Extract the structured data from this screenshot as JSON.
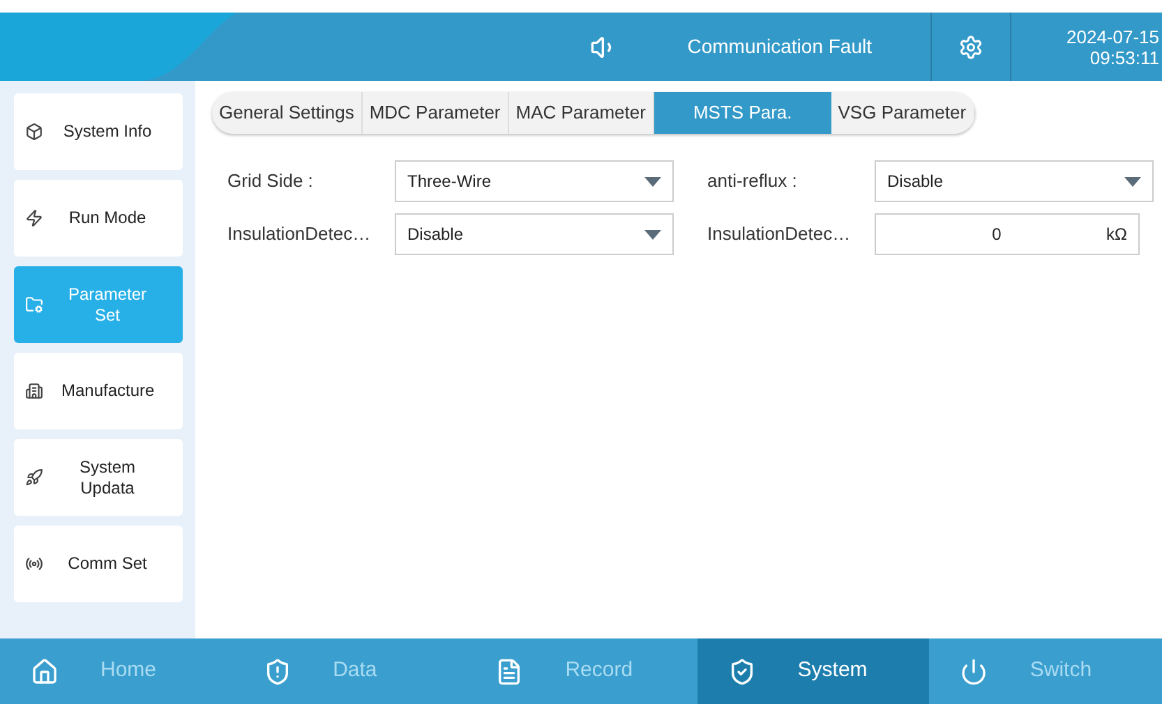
{
  "header": {
    "alarm": "Communication Fault",
    "date": "2024-07-15",
    "time": "09:53:11"
  },
  "sidebar": {
    "items": [
      {
        "label": "System Info",
        "selected": false
      },
      {
        "label": "Run Mode",
        "selected": false
      },
      {
        "label": "Parameter Set",
        "selected": true
      },
      {
        "label": "Manufacture",
        "selected": false
      },
      {
        "label": "System Updata",
        "selected": false
      },
      {
        "label": "Comm Set",
        "selected": false
      }
    ]
  },
  "tabs": [
    {
      "label": "General Settings",
      "selected": false
    },
    {
      "label": "MDC Parameter",
      "selected": false
    },
    {
      "label": "MAC Parameter",
      "selected": false
    },
    {
      "label": "MSTS Para.",
      "selected": true
    },
    {
      "label": "VSG Parameter",
      "selected": false
    }
  ],
  "fields": [
    {
      "label": "Grid Side :",
      "kind": "select",
      "value": "Three-Wire"
    },
    {
      "label": "anti-reflux :",
      "kind": "select",
      "value": "Disable"
    },
    {
      "label": "InsulationDetec…",
      "kind": "select",
      "value": "Disable"
    },
    {
      "label": "InsulationDetec…",
      "kind": "number",
      "value": "0",
      "unit": "kΩ"
    }
  ],
  "nav": [
    {
      "label": "Home",
      "selected": false
    },
    {
      "label": "Data",
      "selected": false
    },
    {
      "label": "Record",
      "selected": false
    },
    {
      "label": "System",
      "selected": true
    },
    {
      "label": "Switch",
      "selected": false
    }
  ]
}
